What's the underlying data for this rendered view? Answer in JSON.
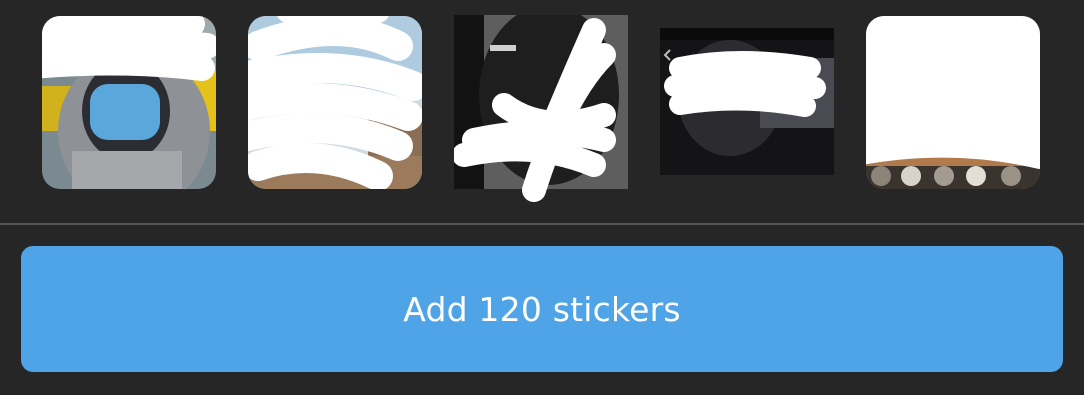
{
  "stickers": [
    {
      "icon": "masked-person-sticker-icon"
    },
    {
      "icon": "outdoor-portrait-sticker-icon"
    },
    {
      "icon": "dark-screenshot-sticker-icon"
    },
    {
      "icon": "dark-video-frame-sticker-icon"
    },
    {
      "icon": "photo-collage-sticker-icon"
    }
  ],
  "add_button": {
    "label": "Add 120 stickers"
  },
  "colors": {
    "background": "#262626",
    "accent": "#4ea4e7",
    "divider": "#555555"
  }
}
